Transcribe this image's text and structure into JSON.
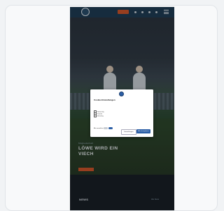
{
  "header": {
    "nav_button_label": "",
    "menu_icon": "hamburger-icon"
  },
  "hero": {
    "kicker": "Mitgliedschaft",
    "title": "Löwe wird ein Viech",
    "cta_label": ""
  },
  "news": {
    "title": "NEWS",
    "link_label": "Alle News"
  },
  "cookie_dialog": {
    "title": "Cookie-Einstellungen",
    "text": "",
    "options": [
      "Notwendig",
      "Statistik",
      "Marketing"
    ],
    "details": "",
    "selection_label": "Alle auswählen",
    "configure_label": "Einstellungen",
    "accept_label": "Alle akzeptieren"
  },
  "colors": {
    "header_bg": "#1f3d56",
    "accent": "#d2562b",
    "primary_button": "#2c5fa6"
  }
}
